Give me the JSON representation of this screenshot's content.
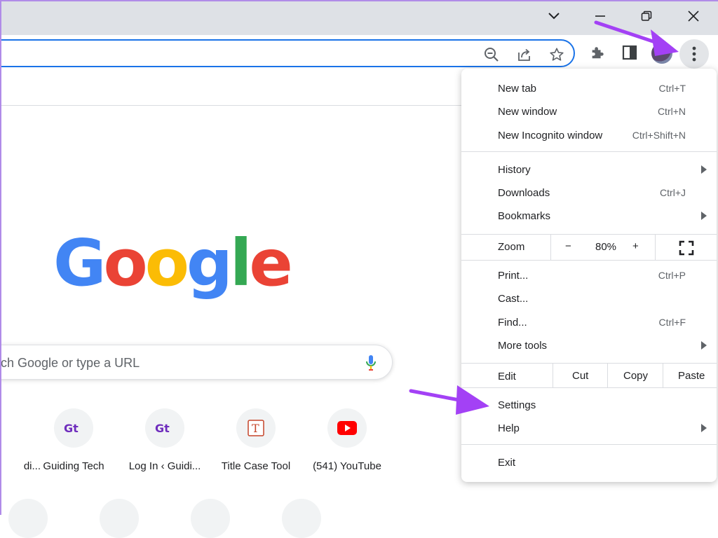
{
  "browser": {
    "omnibox_icons": [
      "zoom-out-icon",
      "share-icon",
      "star-icon"
    ],
    "toolbar_icons": [
      "extensions-icon",
      "side-panel-icon"
    ]
  },
  "ntp": {
    "search_placeholder": "rch Google or type a URL",
    "logo_letters": [
      "G",
      "o",
      "o",
      "g",
      "l",
      "e"
    ],
    "logo_colors": [
      "#4285f4",
      "#ea4335",
      "#fbbc05",
      "#4285f4",
      "#34a853",
      "#ea4335"
    ],
    "shortcuts": [
      {
        "label": "di...",
        "icon": "none"
      },
      {
        "label": "Guiding Tech",
        "icon": "gt-logo-icon"
      },
      {
        "label": "Log In ‹ Guidi...",
        "icon": "gt-logo-icon"
      },
      {
        "label": "Title Case Tool",
        "icon": "t-logo-icon"
      },
      {
        "label": "(541) YouTube",
        "icon": "youtube-icon"
      }
    ]
  },
  "menu": {
    "items": [
      {
        "label": "New tab",
        "shortcut": "Ctrl+T"
      },
      {
        "label": "New window",
        "shortcut": "Ctrl+N"
      },
      {
        "label": "New Incognito window",
        "shortcut": "Ctrl+Shift+N"
      },
      {
        "label": "History",
        "shortcut": ""
      },
      {
        "label": "Downloads",
        "shortcut": "Ctrl+J"
      },
      {
        "label": "Bookmarks",
        "shortcut": ""
      },
      {
        "label": "Print...",
        "shortcut": "Ctrl+P"
      },
      {
        "label": "Cast...",
        "shortcut": ""
      },
      {
        "label": "Find...",
        "shortcut": "Ctrl+F"
      },
      {
        "label": "More tools",
        "shortcut": ""
      },
      {
        "label": "Settings",
        "shortcut": ""
      },
      {
        "label": "Help",
        "shortcut": ""
      },
      {
        "label": "Exit",
        "shortcut": ""
      }
    ],
    "zoom": {
      "label": "Zoom",
      "minus": "−",
      "value": "80%",
      "plus": "+"
    },
    "edit": {
      "label": "Edit",
      "cut": "Cut",
      "copy": "Copy",
      "paste": "Paste"
    }
  },
  "colors": {
    "accent": "#1a73e8",
    "annotation": "#a341f5",
    "titlebar": "#dee1e6"
  }
}
